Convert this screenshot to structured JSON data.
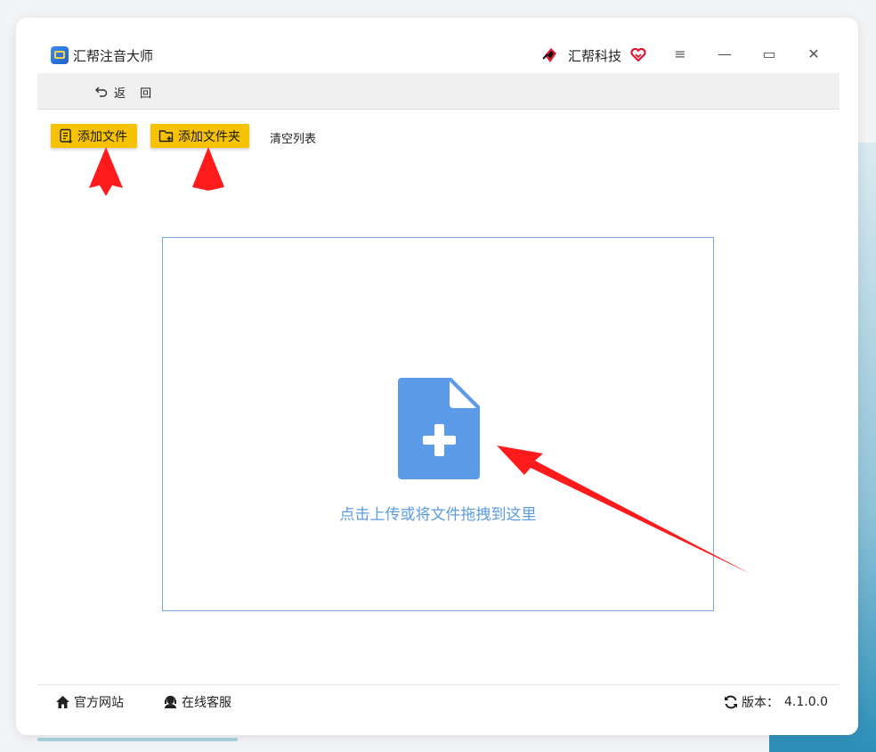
{
  "app": {
    "title": "汇帮注音大师",
    "brand": "汇帮科技"
  },
  "window_controls": {
    "menu": "≡",
    "minimize": "—",
    "maximize": "▭",
    "close": "✕"
  },
  "nav": {
    "back_label": "返 回"
  },
  "toolbar": {
    "add_file": "添加文件",
    "add_folder": "添加文件夹",
    "clear_list": "清空列表"
  },
  "dropzone": {
    "hint": "点击上传或将文件拖拽到这里"
  },
  "footer": {
    "site": "官方网站",
    "support": "在线客服",
    "version_label": "版本：",
    "version_value": "4.1.0.0"
  },
  "colors": {
    "accent_button": "#f7c204",
    "drop_border": "#7aa7e6",
    "icon_blue": "#5b9be0",
    "annotation_red": "#ff1b1b"
  },
  "icons": [
    "app-logo-icon",
    "brand-mark-icon",
    "heart-icon",
    "menu-icon",
    "minimize-icon",
    "maximize-icon",
    "close-icon",
    "back-arrow-icon",
    "file-list-icon",
    "folder-plus-icon",
    "file-plus-icon",
    "home-icon",
    "headset-icon",
    "refresh-icon"
  ]
}
